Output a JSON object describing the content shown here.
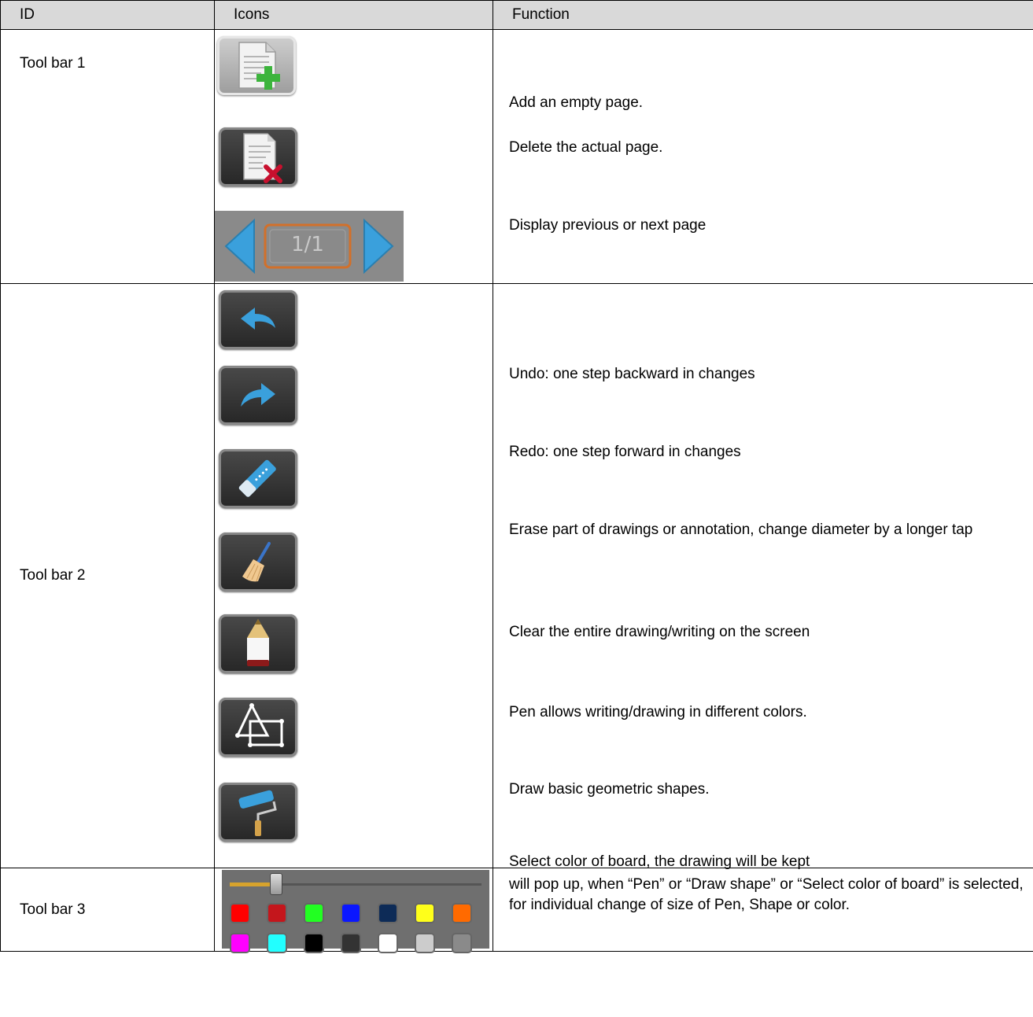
{
  "headers": {
    "id": "ID",
    "icons": "Icons",
    "function": "Function"
  },
  "rows": [
    {
      "id": "Tool bar 1",
      "items": [
        {
          "icon": "add-page-icon",
          "function": "Add an empty page."
        },
        {
          "icon": "delete-page-icon",
          "function": "Delete the actual page."
        },
        {
          "icon": "page-navigation-icon",
          "page_indicator": "1/1",
          "function": "Display previous or next page"
        }
      ]
    },
    {
      "id": "Tool bar 2",
      "items": [
        {
          "icon": "undo-icon",
          "function": "Undo: one step backward in changes"
        },
        {
          "icon": "redo-icon",
          "function": "Redo: one step forward in changes"
        },
        {
          "icon": "eraser-icon",
          "function": "Erase part of drawings or annotation, change diameter by a longer tap"
        },
        {
          "icon": "broom-icon",
          "function": "Clear the entire drawing/writing on the screen"
        },
        {
          "icon": "pencil-icon",
          "function": "Pen allows writing/drawing in different colors."
        },
        {
          "icon": "shapes-icon",
          "function": "Draw basic geometric shapes."
        },
        {
          "icon": "paint-roller-icon",
          "function": "Select color of board, the drawing will be kept"
        }
      ]
    },
    {
      "id": "Tool bar 3",
      "items": [
        {
          "icon": "size-color-palette-icon",
          "slider_level": 0.16,
          "function": "will pop up, when “Pen” or “Draw shape” or “Select color of board” is selected, for individual change of size of Pen, Shape or color."
        }
      ]
    }
  ],
  "palette_colors": [
    "#ff0000",
    "#c4161c",
    "#22ff22",
    "#0a17ff",
    "#0d2b57",
    "#ffff1a",
    "#ff6a00",
    "#ff00ff",
    "#22ffff",
    "#000000",
    "#333333",
    "#ffffff",
    "#cccccc",
    "#8a8a8a"
  ],
  "accent_colors": {
    "header_bg": "#d9d9d9",
    "button_bg": "#2f2f2f",
    "icon_blue": "#3aa0dc",
    "add_green": "#3cb43c",
    "delete_red": "#c8102e"
  }
}
